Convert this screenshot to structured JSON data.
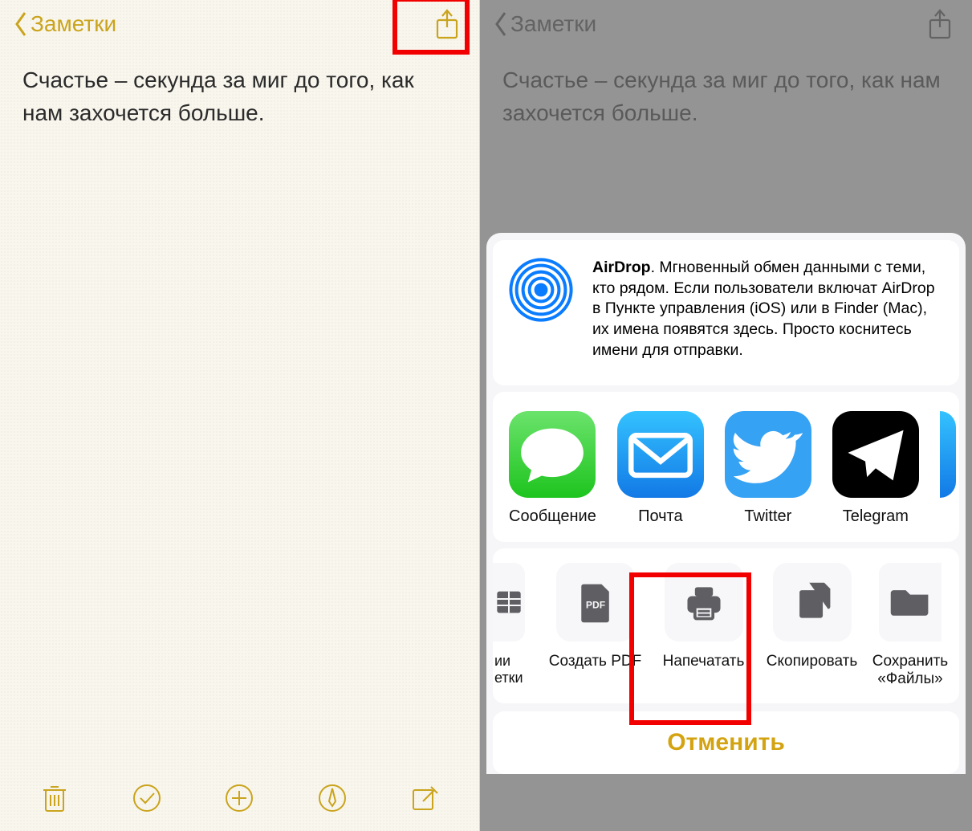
{
  "left": {
    "back_label": "Заметки",
    "note_text": "Счастье – секунда за миг до того, как нам захочется больше."
  },
  "right": {
    "back_label": "Заметки",
    "note_text": "Счастье – секунда за миг до того, как нам захочется больше.",
    "airdrop": {
      "title": "AirDrop",
      "desc": ". Мгновенный обмен данными с теми, кто рядом. Если пользователи включат AirDrop в Пункте управления (iOS) или в Finder (Mac), их имена появятся здесь. Просто коснитесь имени для отправки."
    },
    "apps": [
      {
        "label": "Сообщение"
      },
      {
        "label": "Почта"
      },
      {
        "label": "Twitter"
      },
      {
        "label": "Telegram"
      }
    ],
    "actions": {
      "partial_label": "ии\nетки",
      "pdf": "Создать PDF",
      "print": "Напечатать",
      "copy": "Скопировать",
      "save": "Сохранить «Файлы»"
    },
    "cancel": "Отменить"
  }
}
